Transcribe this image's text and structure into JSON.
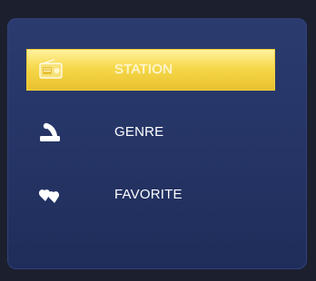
{
  "menu": {
    "items": [
      {
        "label": "STATION",
        "icon": "radio-icon",
        "selected": true
      },
      {
        "label": "GENRE",
        "icon": "gramophone-icon",
        "selected": false
      },
      {
        "label": "FAVORITE",
        "icon": "hearts-icon",
        "selected": false
      }
    ]
  },
  "colors": {
    "background": "#1c1f2e",
    "panel": "#2b3b6e",
    "highlight": "#f6d84a",
    "text": "#ffffff"
  }
}
